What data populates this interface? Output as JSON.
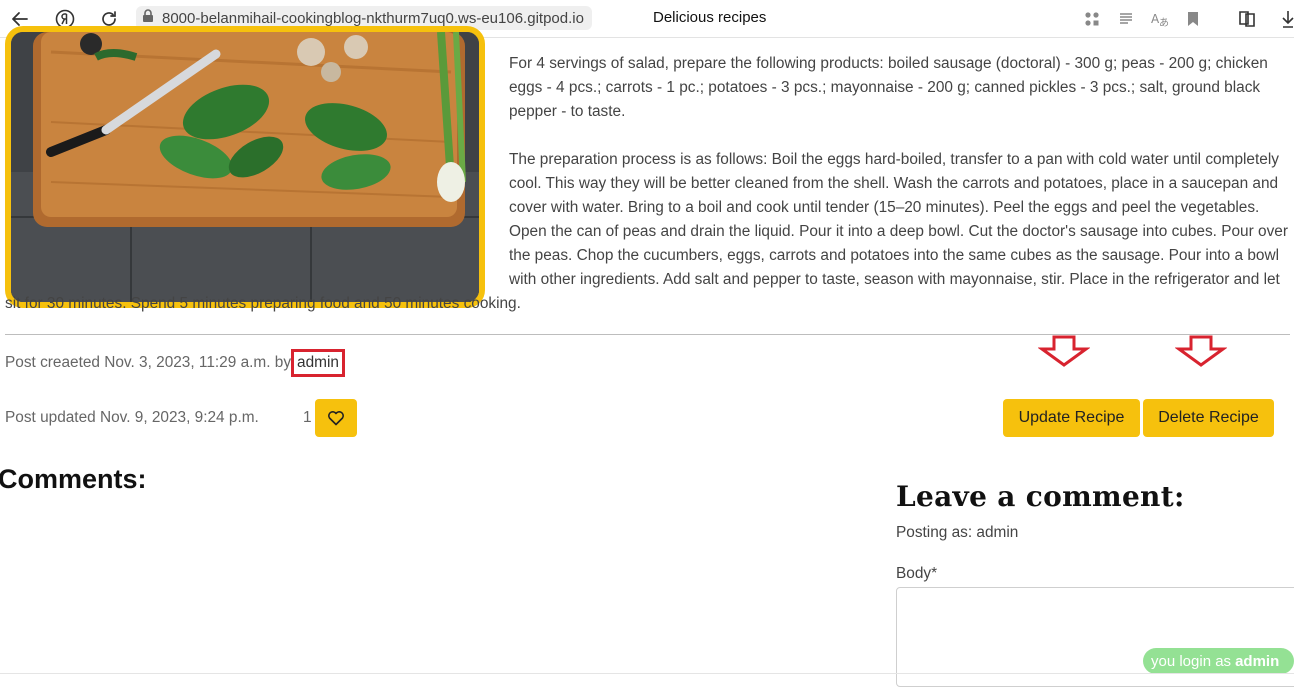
{
  "browser": {
    "url": "8000-belanmihail-cookingblog-nkthurm7uq0.ws-eu106.gitpod.io",
    "tab_title": "Delicious recipes"
  },
  "recipe": {
    "paragraphs": [
      "For 4 servings of salad, prepare the following products: boiled sausage (doctoral) - 300 g; peas - 200 g; chicken eggs - 4 pcs.; carrots - 1 pc.; potatoes - 3 pcs.; mayonnaise - 200 g; canned pickles - 3 pcs.; salt, ground black pepper - to taste.",
      "The preparation process is as follows: Boil the eggs hard-boiled, transfer to a pan with cold water until completely cool. This way they will be better cleaned from the shell. Wash the carrots and potatoes, place in a saucepan and cover with water. Bring to a boil and cook until tender (15–20 minutes). Peel the eggs and peel the vegetables. Open the can of peas and drain the liquid. Pour it into a deep bowl. Cut the doctor's sausage into cubes. Pour over the peas. Chop the cucumbers, eggs, carrots and potatoes into the same cubes as the sausage. Pour into a bowl with other ingredients. Add salt and pepper to taste, season with mayonnaise, stir. Place in the refrigerator and let sit for 30 minutes. Spend 5 minutes preparing food and 50 minutes cooking."
    ]
  },
  "meta": {
    "created_prefix": "Post creaeted Nov. 3, 2023, 11:29 a.m. by",
    "author": "admin",
    "updated": "Post updated Nov. 9, 2023, 9:24 p.m.",
    "like_count": "1"
  },
  "actions": {
    "update_label": "Update Recipe",
    "delete_label": "Delete Recipe"
  },
  "comments": {
    "heading": "Comments:"
  },
  "comment_form": {
    "heading": "Leave a comment:",
    "posting_as": "Posting as: admin",
    "body_label": "Body*"
  },
  "login_status": {
    "prefix": "you login as",
    "user": "admin"
  },
  "colors": {
    "accent": "#f6c10d",
    "highlight_red": "#d8232f",
    "login_pill": "#8fe08f"
  }
}
